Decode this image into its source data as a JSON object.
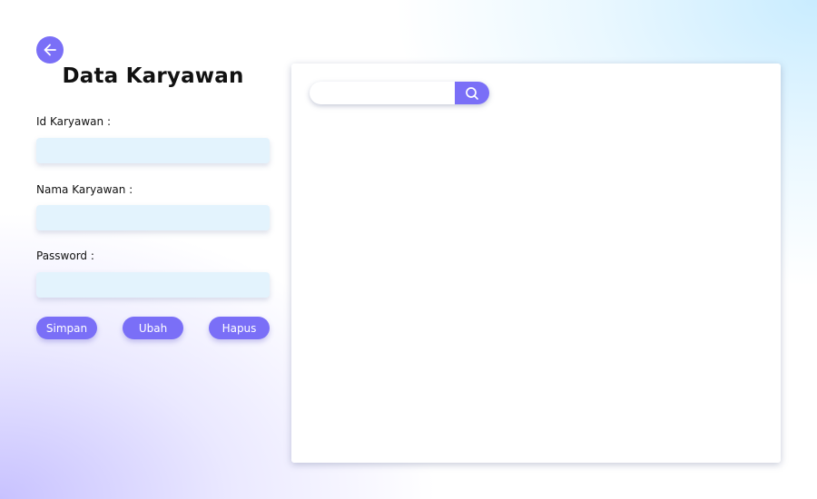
{
  "header": {
    "back_icon": "arrow-left-icon",
    "title": "Data Karyawan"
  },
  "form": {
    "id_label": "Id Karyawan :",
    "id_value": "",
    "name_label": "Nama Karyawan :",
    "name_value": "",
    "password_label": "Password :",
    "password_value": ""
  },
  "actions": {
    "save_label": "Simpan",
    "edit_label": "Ubah",
    "delete_label": "Hapus"
  },
  "table_panel": {
    "search_value": "",
    "search_icon": "search-icon"
  },
  "colors": {
    "accent": "#7a6ff7",
    "input_bg": "#e3f3fd"
  }
}
